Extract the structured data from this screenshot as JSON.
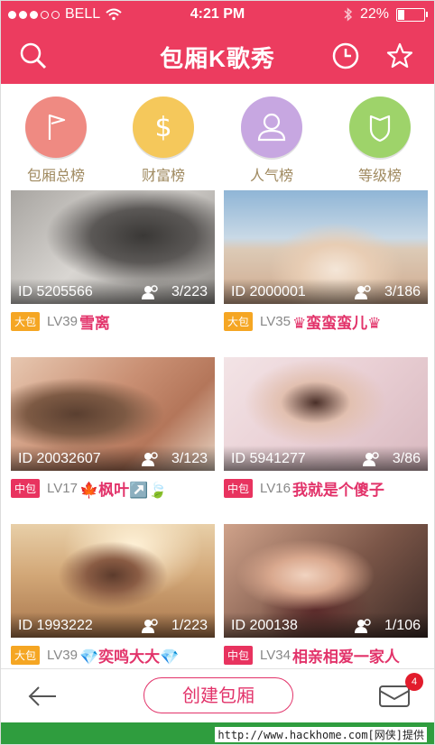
{
  "status": {
    "carrier": "BELL",
    "time": "4:21 PM",
    "battery": "22%"
  },
  "header": {
    "title": "包厢K歌秀"
  },
  "categories": [
    {
      "label": "包厢总榜",
      "icon": "flag-icon",
      "color": "#ef8a82"
    },
    {
      "label": "财富榜",
      "icon": "dollar-icon",
      "color": "#f5c85b"
    },
    {
      "label": "人气榜",
      "icon": "user-icon",
      "color": "#c7a7e1"
    },
    {
      "label": "等级榜",
      "icon": "shield-icon",
      "color": "#9ed36a"
    }
  ],
  "rooms": [
    {
      "id": "ID 5205566",
      "count": "3/223",
      "tag": "大包",
      "level": "LV39",
      "name": "雪离"
    },
    {
      "id": "ID 2000001",
      "count": "3/186",
      "tag": "大包",
      "level": "LV35",
      "name": "♛蛮蛮蛮儿♛"
    },
    {
      "id": "ID 20032607",
      "count": "3/123",
      "tag": "中包",
      "level": "LV17",
      "name": "🍁枫叶↗️🍃"
    },
    {
      "id": "ID 5941277",
      "count": "3/86",
      "tag": "中包",
      "level": "LV16",
      "name": "我就是个傻子"
    },
    {
      "id": "ID 1993222",
      "count": "1/223",
      "tag": "大包",
      "level": "LV39",
      "name": "💎奕鸣大大💎"
    },
    {
      "id": "ID 200138",
      "count": "1/106",
      "tag": "中包",
      "level": "LV34",
      "name": "相亲相爱一家人"
    }
  ],
  "bottom": {
    "create_label": "创建包厢",
    "mail_badge": "4"
  },
  "footer": {
    "text": "http://www.hackhome.com[网侠]提供"
  }
}
